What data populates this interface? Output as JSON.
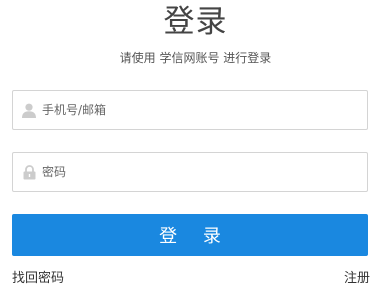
{
  "header": {
    "title": "登录",
    "subtitle": "请使用 学信网账号 进行登录"
  },
  "form": {
    "username": {
      "placeholder": "手机号/邮箱",
      "value": "",
      "icon": "user-icon"
    },
    "password": {
      "placeholder": "密码",
      "value": "",
      "icon": "lock-icon"
    },
    "submit_label": "登 录"
  },
  "links": {
    "forgot_password": "找回密码",
    "register": "注册"
  },
  "colors": {
    "primary": "#1a88e0",
    "border": "#d4d4d4",
    "icon": "#cccccc",
    "text": "#333333"
  }
}
